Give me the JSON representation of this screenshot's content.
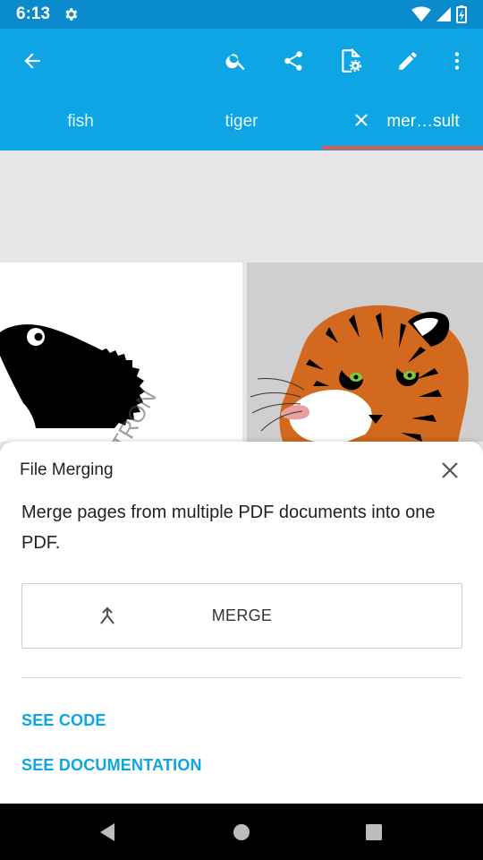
{
  "status_bar": {
    "time": "6:13"
  },
  "tabs": [
    {
      "label": "fish"
    },
    {
      "label": "tiger"
    },
    {
      "label": "mer…sult"
    }
  ],
  "sheet": {
    "title": "File Merging",
    "description": "Merge pages from multiple PDF documents into one PDF.",
    "merge_label": "MERGE",
    "see_code": "SEE CODE",
    "see_documentation": "SEE DOCUMENTATION"
  },
  "icons": {
    "back": "arrow-back-icon",
    "search": "search-icon",
    "share": "share-icon",
    "document_settings": "document-settings-icon",
    "edit": "pencil-icon",
    "overflow": "more-vert-icon"
  },
  "colors": {
    "app_bar": "#0ea5e5",
    "status_bar": "#0a8ccc",
    "tab_indicator": "#e2574c",
    "link": "#0ea5e5"
  }
}
